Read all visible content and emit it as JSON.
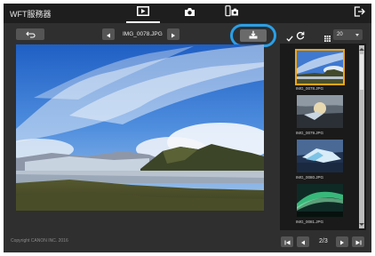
{
  "app": {
    "title": "WFT服務器"
  },
  "mode_tabs": [
    {
      "name": "playback",
      "icon": "play-icon",
      "active": true
    },
    {
      "name": "camera",
      "icon": "camera-icon",
      "active": false
    },
    {
      "name": "remote",
      "icon": "phone-camera-icon",
      "active": false
    }
  ],
  "toolbar": {
    "filename": "IMG_0078.JPG"
  },
  "thumbnails": {
    "size_value": "20",
    "items": [
      {
        "label": "IMG_0078.JPG",
        "selected": true
      },
      {
        "label": "IMG_0079.JPG",
        "selected": false
      },
      {
        "label": "IMG_0080.JPG",
        "selected": false
      },
      {
        "label": "IMG_0081.JPG",
        "selected": false
      }
    ]
  },
  "pager": {
    "page_text": "2/3"
  },
  "footer": {
    "copyright": "Copyright CANON INC. 2016"
  },
  "colors": {
    "highlight_ring": "#29a0e8",
    "selected_border": "#f2a516"
  }
}
